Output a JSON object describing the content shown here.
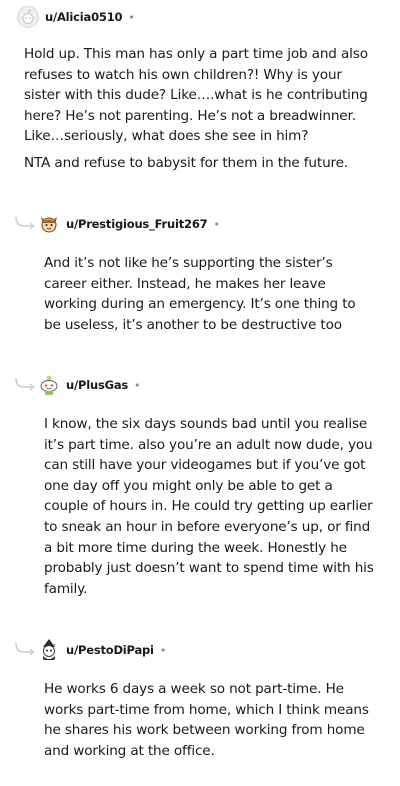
{
  "comments": [
    {
      "username": "u/Alicia0510",
      "separator": "•",
      "avatar_icon": "reddit-default-avatar-icon",
      "paragraphs": [
        "Hold up. This man has only a part time job and also refuses to watch his own children?! Why is your sister with this dude? Like….what is he contributing here? He’s not parenting. He’s not a breadwinner. Like…seriously, what does she see in him?",
        "NTA and refuse to babysit for them in the future."
      ]
    },
    {
      "username": "u/Prestigious_Fruit267",
      "separator": "•",
      "avatar_icon": "snoo-fox-avatar-icon",
      "paragraphs": [
        "And it’s not like he’s supporting the sister’s career either. Instead, he makes her leave working during an emergency. It’s one thing to be useless, it’s another to be destructive too"
      ]
    },
    {
      "username": "u/PlusGas",
      "separator": "•",
      "avatar_icon": "snoo-green-avatar-icon",
      "paragraphs": [
        "I know, the six days sounds bad until you realise it’s part time. also you’re an adult now dude, you can still have your videogames but if you’ve got one day off you might only be able to get a couple of hours in. He could try getting up earlier to sneak an hour in before everyone’s up, or find a bit more time during the week. Honestly he probably just doesn’t want to spend time with his family."
      ]
    },
    {
      "username": "u/PestoDiPapi",
      "separator": "•",
      "avatar_icon": "snoo-wizard-avatar-icon",
      "paragraphs": [
        "He works 6 days a week so not part-time. He works part-time from home, which I think means he shares his work between working from home and working at the office."
      ]
    }
  ]
}
